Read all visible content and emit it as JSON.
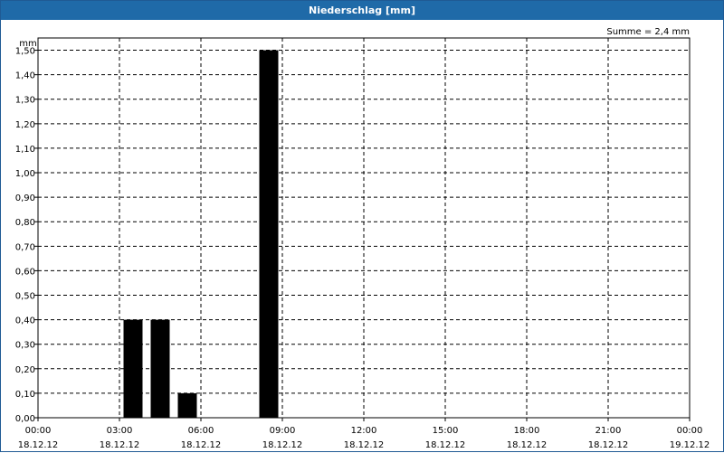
{
  "window": {
    "title": "Niederschlag [mm]"
  },
  "chart_data": {
    "type": "bar",
    "title": "Niederschlag [mm]",
    "ylabel": "mm",
    "annotation": "Summe = 2,4 mm",
    "ylim": [
      0,
      1.55
    ],
    "yticks": [
      "0,00",
      "0,10",
      "0,20",
      "0,30",
      "0,40",
      "0,50",
      "0,60",
      "0,70",
      "0,80",
      "0,90",
      "1,00",
      "1,10",
      "1,20",
      "1,30",
      "1,40",
      "1,50"
    ],
    "xlim_hours": [
      0,
      24
    ],
    "xticks": [
      {
        "time": "00:00",
        "date": "18.12.12"
      },
      {
        "time": "03:00",
        "date": "18.12.12"
      },
      {
        "time": "06:00",
        "date": "18.12.12"
      },
      {
        "time": "09:00",
        "date": "18.12.12"
      },
      {
        "time": "12:00",
        "date": "18.12.12"
      },
      {
        "time": "15:00",
        "date": "18.12.12"
      },
      {
        "time": "18:00",
        "date": "18.12.12"
      },
      {
        "time": "21:00",
        "date": "18.12.12"
      },
      {
        "time": "00:00",
        "date": "19.12.12"
      }
    ],
    "grid": true,
    "bar_color": "#000000",
    "bars": [
      {
        "x": "18.12.12 03:00",
        "value": 0.4
      },
      {
        "x": "18.12.12 04:00",
        "value": 0.4
      },
      {
        "x": "18.12.12 05:00",
        "value": 0.1
      },
      {
        "x": "18.12.12 08:00",
        "value": 1.5
      }
    ]
  }
}
